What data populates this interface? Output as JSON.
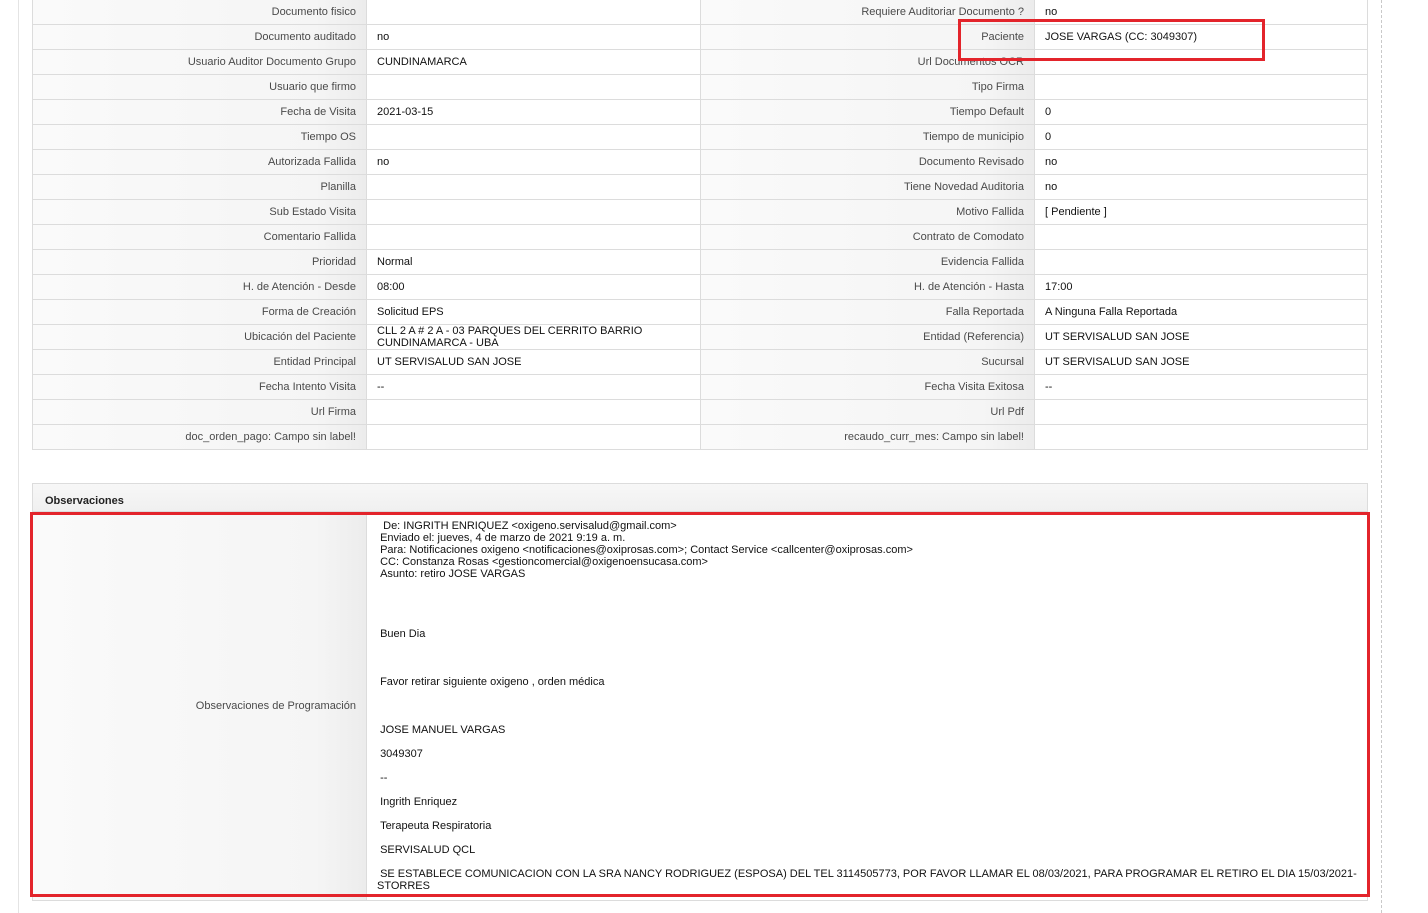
{
  "detail_fields": [
    {
      "label_left": "Documento fisico",
      "value_left": "",
      "label_right": "Requiere Auditoriar Documento ?",
      "value_right": "no"
    },
    {
      "label_left": "Documento auditado",
      "value_left": "no",
      "label_right": "Paciente",
      "value_right": "JOSE VARGAS (CC: 3049307)"
    },
    {
      "label_left": "Usuario Auditor Documento Grupo",
      "value_left": "CUNDINAMARCA",
      "label_right": "Url Documentos OCR",
      "value_right": ""
    },
    {
      "label_left": "Usuario que firmo",
      "value_left": "",
      "label_right": "Tipo Firma",
      "value_right": ""
    },
    {
      "label_left": "Fecha de Visita",
      "value_left": "2021-03-15",
      "label_right": "Tiempo Default",
      "value_right": "0"
    },
    {
      "label_left": "Tiempo OS",
      "value_left": "",
      "label_right": "Tiempo de municipio",
      "value_right": "0"
    },
    {
      "label_left": "Autorizada Fallida",
      "value_left": "no",
      "label_right": "Documento Revisado",
      "value_right": "no"
    },
    {
      "label_left": "Planilla",
      "value_left": "",
      "label_right": "Tiene Novedad Auditoria",
      "value_right": "no"
    },
    {
      "label_left": "Sub Estado Visita",
      "value_left": "",
      "label_right": "Motivo Fallida",
      "value_right": "[ Pendiente ]"
    },
    {
      "label_left": "Comentario Fallida",
      "value_left": "",
      "label_right": "Contrato de Comodato",
      "value_right": ""
    },
    {
      "label_left": "Prioridad",
      "value_left": "Normal",
      "label_right": "Evidencia Fallida",
      "value_right": ""
    },
    {
      "label_left": "H. de Atención - Desde",
      "value_left": "08:00",
      "label_right": "H. de Atención - Hasta",
      "value_right": "17:00"
    },
    {
      "label_left": "Forma de Creación",
      "value_left": "Solicitud EPS",
      "label_right": "Falla Reportada",
      "value_right": "A Ninguna Falla Reportada"
    },
    {
      "label_left": "Ubicación del Paciente",
      "value_left": "CLL 2 A # 2 A - 03 PARQUES DEL CERRITO BARRIO CUNDINAMARCA - UBA",
      "label_right": "Entidad (Referencia)",
      "value_right": "UT SERVISALUD SAN JOSE"
    },
    {
      "label_left": "Entidad Principal",
      "value_left": "UT SERVISALUD SAN JOSE",
      "label_right": "Sucursal",
      "value_right": "UT SERVISALUD SAN JOSE"
    },
    {
      "label_left": "Fecha Intento Visita",
      "value_left": "--",
      "label_right": "Fecha Visita Exitosa",
      "value_right": "--"
    },
    {
      "label_left": "Url Firma",
      "value_left": "",
      "label_right": "Url Pdf",
      "value_right": ""
    },
    {
      "label_left": "doc_orden_pago: Campo sin label!",
      "value_left": "",
      "label_right": "recaudo_curr_mes: Campo sin label!",
      "value_right": ""
    }
  ],
  "observaciones": {
    "panel_title": "Observaciones",
    "programacion": {
      "label": "Observaciones de Programación",
      "value": "  De: INGRITH ENRIQUEZ <oxigeno.servisalud@gmail.com>\n Enviado el: jueves, 4 de marzo de 2021 9:19 a. m.\n Para: Notificaciones oxigeno <notificaciones@oxiprosas.com>; Contact Service <callcenter@oxiprosas.com>\n CC: Constanza Rosas <gestioncomercial@oxigenoensucasa.com>\n Asunto: retiro JOSE VARGAS\n\n\n\n\n Buen Dia\n\n\n\n Favor retirar siguiente oxigeno , orden médica\n\n\n\n JOSE MANUEL VARGAS\n\n 3049307\n\n --\n\n Ingrith Enriquez\n\n Terapeuta Respiratoria\n\n SERVISALUD QCL\n\n SE ESTABLECE COMUNICACION CON LA SRA NANCY RODRIGUEZ (ESPOSA) DEL TEL 3114505773, POR FAVOR LLAMAR EL 08/03/2021, PARA PROGRAMAR EL RETIRO EL DIA 15/03/2021-STORRES"
    }
  },
  "colors": {
    "annotation_red": "#e3242b",
    "cell_border": "#dcdcdc",
    "label_background": "#f5f5f5",
    "value_background": "#ffffff"
  }
}
